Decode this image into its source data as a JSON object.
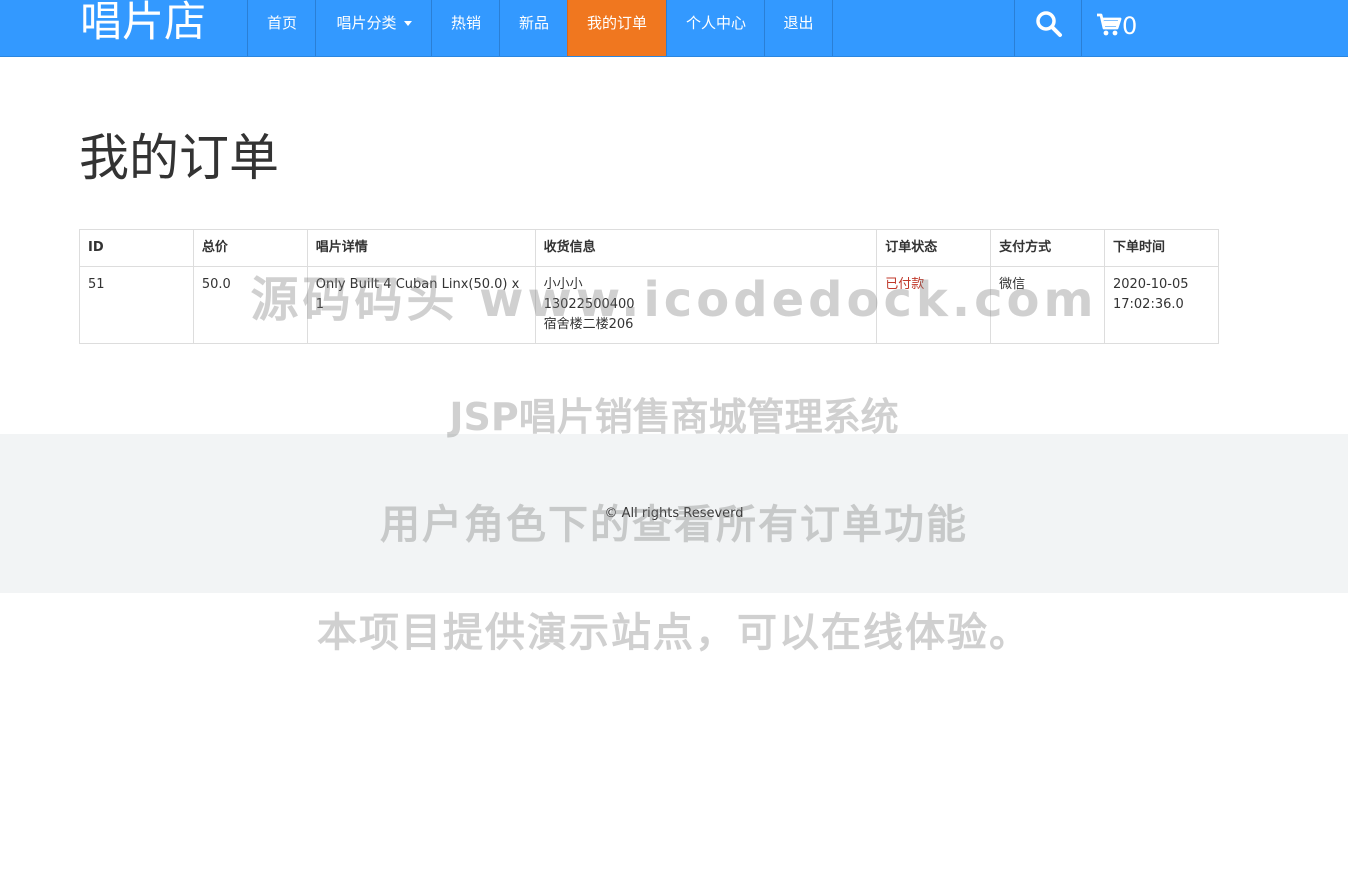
{
  "brand": "唱片店",
  "nav": {
    "home": "首页",
    "categories": "唱片分类",
    "hot": "热销",
    "new": "新品",
    "orders": "我的订单",
    "profile": "个人中心",
    "logout": "退出"
  },
  "cart_count": "0",
  "page_title": "我的订单",
  "table": {
    "headers": [
      "ID",
      "总价",
      "唱片详情",
      "收货信息",
      "订单状态",
      "支付方式",
      "下单时间"
    ],
    "rows": [
      {
        "id": "51",
        "total": "50.0",
        "detail": "Only Built 4 Cuban Linx(50.0) x 1",
        "ship_name": "小小小",
        "ship_phone": "13022500400",
        "ship_address": "宿舍楼二楼206",
        "status": "已付款",
        "payment": "微信",
        "time_date": "2020-10-05",
        "time_clock": "17:02:36.0"
      }
    ]
  },
  "footer": "© All rights Reseverd",
  "watermarks": {
    "line1": "源码码头 www.icodedock.com",
    "line2": "JSP唱片销售商城管理系统",
    "line3": "用户角色下的查看所有订单功能",
    "line4": "本项目提供演示站点，可以在线体验。"
  },
  "colors": {
    "navbar": "#3399ff",
    "active_tab": "#f0771f",
    "status_paid": "#c0392b"
  }
}
